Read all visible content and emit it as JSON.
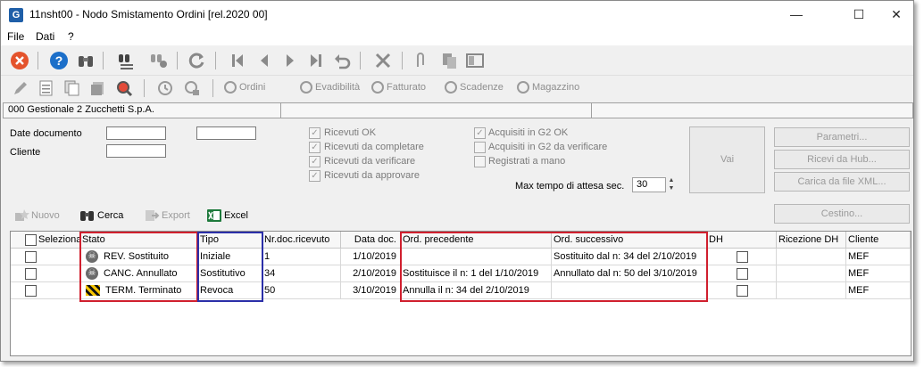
{
  "window": {
    "title": "11nsht00 - Nodo Smistamento Ordini  [rel.2020 00]",
    "app_icon": "G",
    "minimize": "—",
    "maximize": "☐",
    "close": "✕"
  },
  "menu": {
    "items": [
      "File",
      "Dati",
      "?"
    ]
  },
  "toolbar_nav": {
    "ordini": "Ordini",
    "evadibilita": "Evadibilità",
    "fatturato": "Fatturato",
    "scadenze": "Scadenze",
    "magazzino": "Magazzino"
  },
  "company": {
    "label": "000 Gestionale 2 Zucchetti S.p.A."
  },
  "filters": {
    "date_label": "Date documento",
    "cliente_label": "Cliente",
    "checks_left": [
      {
        "label": "Ricevuti OK",
        "checked": true
      },
      {
        "label": "Ricevuti da completare",
        "checked": true
      },
      {
        "label": "Ricevuti da verificare",
        "checked": true
      },
      {
        "label": "Ricevuti da approvare",
        "checked": true
      }
    ],
    "checks_right": [
      {
        "label": "Acquisiti in G2 OK",
        "checked": true
      },
      {
        "label": "Acquisiti in G2 da verificare",
        "checked": false
      },
      {
        "label": "Registrati a mano",
        "checked": false
      }
    ],
    "max_wait_label": "Max tempo di attesa sec.",
    "max_wait_value": "30",
    "vai": "Vai",
    "parametri": "Parametri...",
    "ricevi_hub": "Ricevi da Hub...",
    "carica_xml": "Carica da file XML...",
    "cestino": "Cestino..."
  },
  "actions": {
    "nuovo": "Nuovo",
    "cerca": "Cerca",
    "export": "Export",
    "excel": "Excel"
  },
  "table": {
    "headers": {
      "seleziona": "Seleziona",
      "stato": "Stato",
      "tipo": "Tipo",
      "nr_doc": "Nr.doc.ricevuto",
      "data_doc": "Data doc.",
      "ord_prec": "Ord. precedente",
      "ord_succ": "Ord. successivo",
      "dh": "DH",
      "ricezione_dh": "Ricezione DH",
      "cliente": "Cliente"
    },
    "rows": [
      {
        "stato": "REV. Sostituito",
        "icon": "skull-icon",
        "tipo": "Iniziale",
        "nr_doc": "1",
        "data_doc": "1/10/2019",
        "ord_prec": "",
        "ord_succ": "Sostituito dal n: 34 del  2/10/2019",
        "cliente": "MEF"
      },
      {
        "stato": "CANC. Annullato",
        "icon": "skull-icon",
        "tipo": "Sostitutivo",
        "nr_doc": "34",
        "data_doc": "2/10/2019",
        "ord_prec": "Sostituisce il n: 1 del  1/10/2019",
        "ord_succ": "Annullato dal n: 50 del  3/10/2019",
        "cliente": "MEF"
      },
      {
        "stato": "TERM. Terminato",
        "icon": "hazard-stripe-icon",
        "tipo": "Revoca",
        "nr_doc": "50",
        "data_doc": "3/10/2019",
        "ord_prec": "Annulla il n: 34 del  2/10/2019",
        "ord_succ": "",
        "cliente": "MEF"
      }
    ]
  },
  "colors": {
    "highlight_red": "#d01f2e",
    "highlight_blue": "#2b2fa8"
  }
}
